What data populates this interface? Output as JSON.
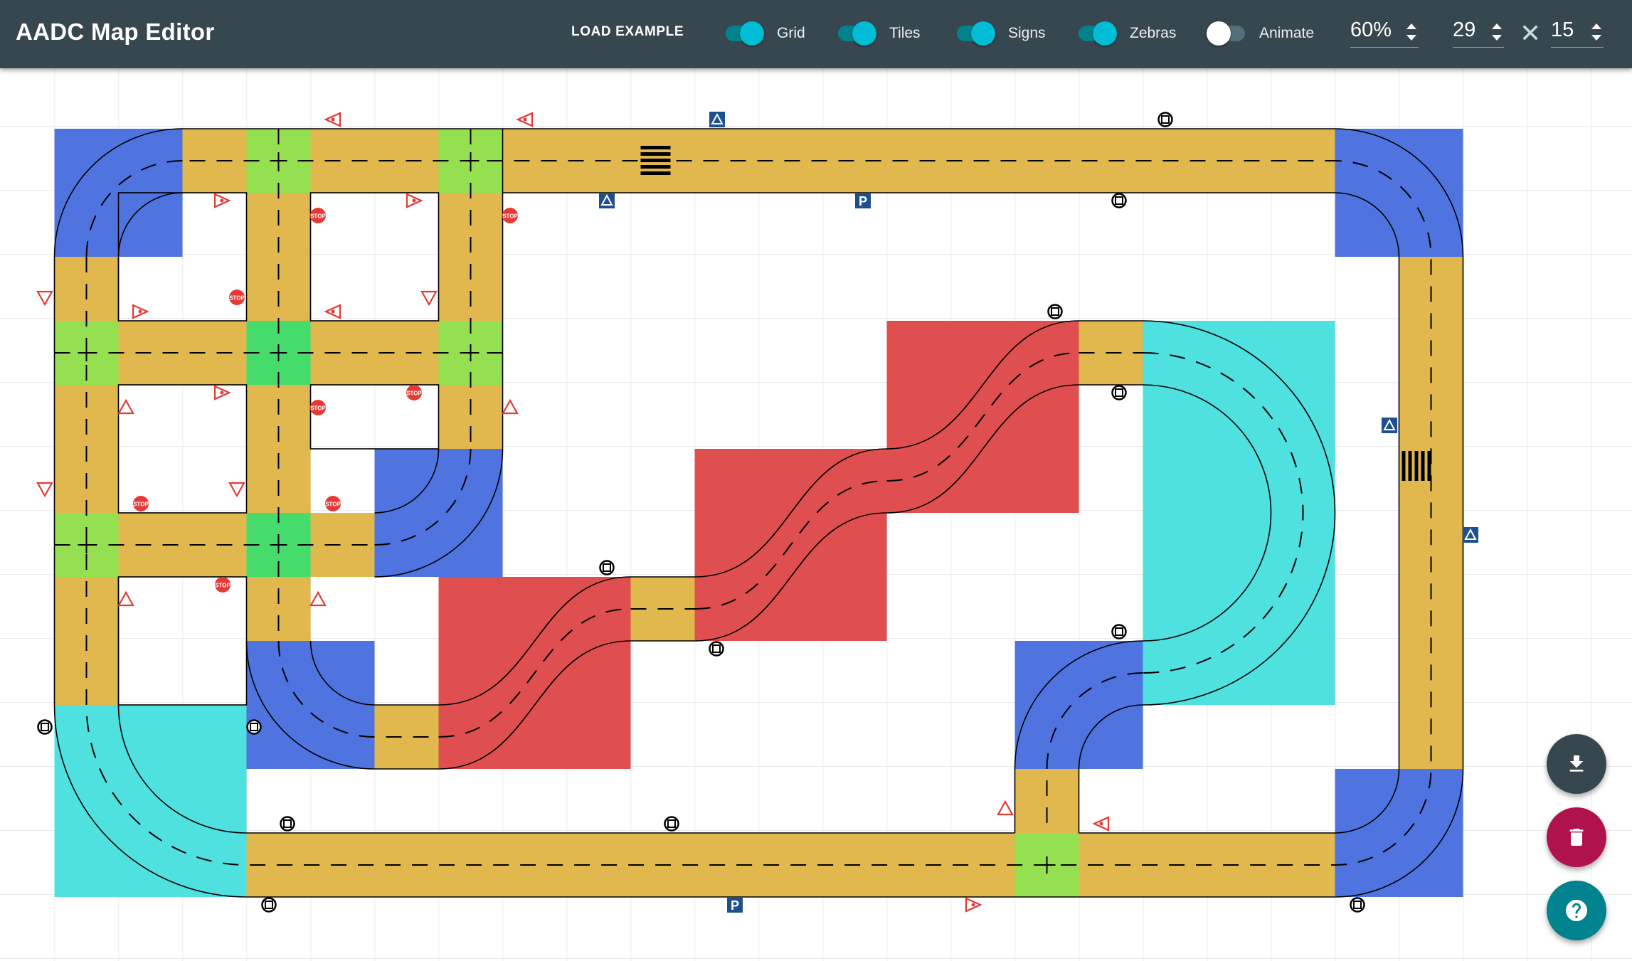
{
  "app": {
    "title": "AADC Map Editor"
  },
  "toolbar": {
    "load_example_label": "LOAD EXAMPLE",
    "toggles": [
      {
        "label": "Grid",
        "on": true
      },
      {
        "label": "Tiles",
        "on": true
      },
      {
        "label": "Signs",
        "on": true
      },
      {
        "label": "Zebras",
        "on": true
      },
      {
        "label": "Animate",
        "on": false
      }
    ],
    "zoom": "60%",
    "grid_cols": "29",
    "grid_rows": "15",
    "times_symbol": "✕"
  },
  "colors": {
    "toolbar_bg": "#37474f",
    "road_straight": "#e0b84e",
    "intersection": "#94e050",
    "intersection_center": "#45dc6c",
    "curve_blue": "#4f74e0",
    "curve_cyan": "#4fe0e0",
    "s_curve_red": "#e04f4f",
    "sign_red": "#e53935",
    "sign_blue": "#1e4f8f",
    "fab_download": "#37474f",
    "fab_delete": "#b0124e",
    "fab_help": "#00838f"
  },
  "fabs": {
    "download_icon": "download-icon",
    "delete_icon": "trash-icon",
    "help_icon": "help-icon"
  },
  "sign_labels": {
    "stop": "STOP",
    "parking": "P"
  }
}
